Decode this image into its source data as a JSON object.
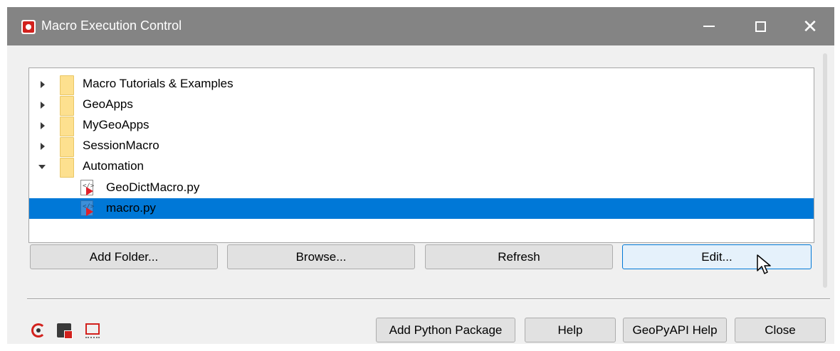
{
  "window": {
    "title": "Macro Execution Control",
    "controls": {
      "minimize": "—",
      "maximize": "□",
      "close": "✕"
    }
  },
  "tree": {
    "items": [
      {
        "label": "Macro Tutorials & Examples",
        "type": "folder",
        "expanded": false
      },
      {
        "label": "GeoApps",
        "type": "folder",
        "expanded": false
      },
      {
        "label": "MyGeoApps",
        "type": "folder",
        "expanded": false
      },
      {
        "label": "SessionMacro",
        "type": "folder",
        "expanded": false
      },
      {
        "label": "Automation",
        "type": "folder",
        "expanded": true
      },
      {
        "label": "GeoDictMacro.py",
        "type": "python-macro-file",
        "selected": false
      },
      {
        "label": "macro.py",
        "type": "python-macro-file",
        "selected": true
      }
    ]
  },
  "actions": {
    "add_folder": "Add Folder...",
    "browse": "Browse...",
    "refresh": "Refresh",
    "edit": "Edit..."
  },
  "footer": {
    "icons": [
      "run-macro-icon",
      "stop-macro-icon",
      "record-macro-icon"
    ],
    "add_python_package": "Add Python Package",
    "help": "Help",
    "geopyapi_help": "GeoPyAPI Help",
    "close": "Close"
  },
  "colors": {
    "titlebar": "#848484",
    "selection": "#0078d7",
    "accent_red": "#d2211d",
    "folder": "#fde08f"
  }
}
